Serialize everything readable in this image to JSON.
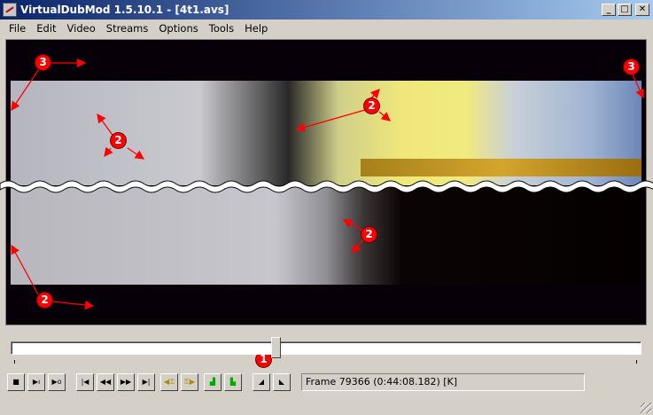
{
  "window": {
    "title": "VirtualDubMod 1.5.10.1 - [4t1.avs]",
    "buttons": {
      "minimize": "_",
      "maximize": "□",
      "close": "✕"
    }
  },
  "menu": [
    "File",
    "Edit",
    "Video",
    "Streams",
    "Options",
    "Tools",
    "Help"
  ],
  "annotations": {
    "color": "#ff0000",
    "markers": [
      "3",
      "3",
      "2",
      "2",
      "2",
      "2",
      "3",
      "1"
    ]
  },
  "status": {
    "frame_info": "Frame 79366 (0:44:08.182) [K]"
  },
  "timeline": {
    "position_fraction": 0.42
  },
  "toolbar_icons": [
    "stop-icon",
    "play-input-icon",
    "play-output-icon",
    "go-start-icon",
    "prev-frame-icon",
    "next-frame-icon",
    "go-end-icon",
    "prev-keyframe-icon",
    "next-keyframe-icon",
    "prev-scene-icon",
    "next-scene-icon",
    "mark-in-icon",
    "mark-out-icon"
  ]
}
